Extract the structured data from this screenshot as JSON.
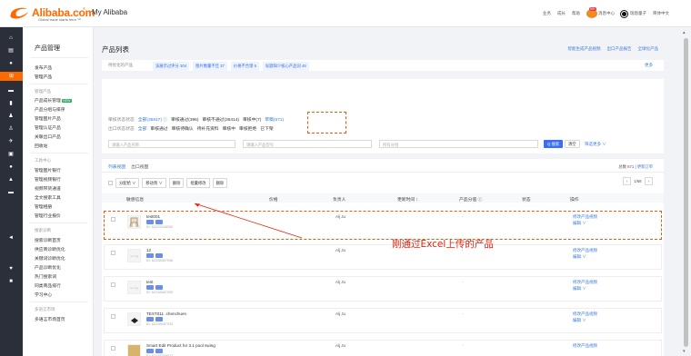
{
  "topbar": {
    "logo_text": "Alibaba.com",
    "logo_tagline": "Global trade starts here.™",
    "logo_mark": "®",
    "app_title": "My Alibaba",
    "links": [
      "业务",
      "成长",
      "帮助"
    ],
    "message_count": "99+",
    "message_label": "消息中心",
    "user_name": "瑞恩童子",
    "language": "简体中文"
  },
  "sidenav": {
    "title": "产品管理",
    "items_a": [
      "发布产品",
      "管理产品"
    ],
    "group_b": "管理产品",
    "items_b": [
      "产品成长管理",
      "产品分组与排序",
      "管理图片产品",
      "管理认证产品",
      "关联出口产品",
      "回收站"
    ],
    "new_badge": "NEW",
    "group_c": "工具中心",
    "items_c": [
      "管理图片银行",
      "管理视频银行",
      "视频带货通道",
      "全文搜索工具",
      "管理相册",
      "管理行业报价"
    ],
    "group_d": "搜索诊断",
    "items_d": [
      "搜索诊断首页",
      "供应商诊断优化",
      "关键词诊断优化",
      "产品诊断优化",
      "热门搜索词",
      "同类商品排行",
      "学习中心"
    ],
    "group_e": "多语言市场",
    "items_e": [
      "多语言市场首页"
    ]
  },
  "main": {
    "page_title": "产品列表",
    "head_links": [
      "智能生成产品视频",
      "出口产品报告",
      "全球化产品"
    ],
    "quick": {
      "label": "待优化的产品",
      "tags": [
        "该展示过评分 304",
        "图片数量不佳 37",
        "价格不合理 6",
        "标题缺少核心产品词 49"
      ],
      "more": "更多"
    },
    "filters": {
      "row1_label": "审核状态状态",
      "row1_values": [
        "全部(35817) ⓘ",
        "审核通过(396)",
        "审核不通过(35414)",
        "审核中(7)",
        "草稿(671)"
      ],
      "row2_label": "出口状态状态",
      "row2_values": [
        "全部",
        "审核通过",
        "审核待确认",
        "待补充资料",
        "审核中",
        "审核拒绝",
        "已下架"
      ],
      "search_placeholder": "请输入产品名称",
      "model_placeholder": "请输入产品型号",
      "owner_placeholder": "所有分组",
      "search_btn": "Q 搜索",
      "clear_btn": "清空",
      "more_filters": "筛选更多 ∨"
    },
    "list": {
      "tabs": [
        "列表视图",
        "出口视图"
      ],
      "count_text": "总数 671 |",
      "count_link": "更新订单",
      "toolbar": [
        "分配给 ∨",
        "移动到 ∨",
        "删除",
        "批量修改",
        "删除"
      ],
      "pager_page": "1/68",
      "headers": [
        "敏感信息",
        "价格",
        "负责人",
        "更新时间 ↕",
        "产品分值 ⓘ",
        "状态",
        "操作"
      ],
      "rows": [
        {
          "name": "test001",
          "id": "ID: 62225248340",
          "owner": "Alj Ju",
          "score": "-",
          "act1": "修改产品视频",
          "act2": "编辑 ∨"
        },
        {
          "name": "12",
          "id": "ID: 62238587936",
          "owner": "Alj Ju",
          "score": "-",
          "act1": "修改产品视频",
          "act2": "编辑 ∨"
        },
        {
          "name": "test",
          "id": "ID: 62238587935",
          "owner": "Alj Ju",
          "score": "-",
          "act1": "修改产品视频",
          "act2": "编辑 ∨"
        },
        {
          "name": "TEST011 .chenchuen",
          "id": "ID: 62238587933",
          "owner": "Alj Ju",
          "score": "-",
          "act1": "修改产品视频",
          "act2": "编辑 ∨"
        },
        {
          "name": "Smart Edit Product for 3.1 pool swing",
          "id": "ID: 62238758027",
          "owner": "Alj Ju",
          "score": "-",
          "act1": "修改产品视频",
          "act2": "编辑 ∨"
        }
      ]
    }
  },
  "annotation": "刚通过Excel上传的产品",
  "colors": {
    "brand": "#ff6a00",
    "link": "#3a7be0",
    "annotation": "#e8200c",
    "rail": "#2b2f3a"
  }
}
